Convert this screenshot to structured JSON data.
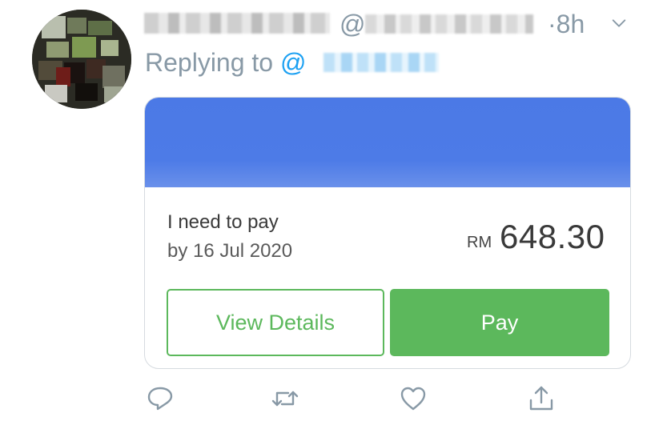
{
  "tweet": {
    "handle_prefix": "@",
    "time": "·8h",
    "replying_label": "Replying to",
    "mention_prefix": "@"
  },
  "card": {
    "line1": "I need to pay",
    "line2": "by 16 Jul 2020",
    "currency": "RM",
    "amount": "648.30",
    "view_details_label": "View Details",
    "pay_label": "Pay"
  },
  "colors": {
    "banner": "#4b79e6",
    "green": "#5cb85c",
    "meta_grey": "#8899a6",
    "link_blue": "#1da1f2"
  },
  "icons": {
    "reply": "reply-icon",
    "retweet": "retweet-icon",
    "like": "heart-icon",
    "share": "share-icon",
    "more": "chevron-down-icon"
  }
}
